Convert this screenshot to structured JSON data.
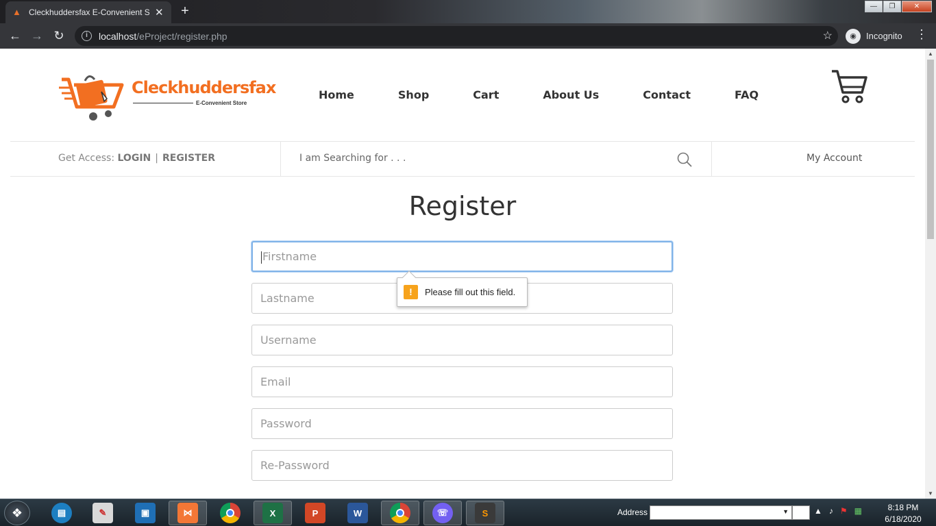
{
  "browser": {
    "tab_title": "Cleckhuddersfax E-Convenient St",
    "tab_close": "✕",
    "new_tab": "+",
    "url_host": "localhost",
    "url_path": "/eProject/register.php",
    "incognito_label": "Incognito"
  },
  "site": {
    "brand": "Cleckhuddersfax",
    "tagline": "E-Convenient Store",
    "nav": [
      "Home",
      "Shop",
      "Cart",
      "About Us",
      "Contact",
      "FAQ"
    ],
    "access_prefix": "Get Access:",
    "login": "LOGIN",
    "separator": "|",
    "register": "REGISTER",
    "search_placeholder": "I am Searching for . . .",
    "my_account": "My Account",
    "brand_color": "#f26f21"
  },
  "form": {
    "title": "Register",
    "fields": [
      {
        "placeholder": "Firstname",
        "value": ""
      },
      {
        "placeholder": "Lastname",
        "value": ""
      },
      {
        "placeholder": "Username",
        "value": ""
      },
      {
        "placeholder": "Email",
        "value": ""
      },
      {
        "placeholder": "Password",
        "value": ""
      },
      {
        "placeholder": "Re-Password",
        "value": ""
      }
    ],
    "validation_message": "Please fill out this field.",
    "validation_icon": "!"
  },
  "taskbar": {
    "address_label": "Address",
    "time": "8:18 PM",
    "date": "6/18/2020",
    "apps": [
      "file-explorer",
      "paint",
      "virtualbox",
      "xampp",
      "chrome",
      "excel",
      "powerpoint",
      "word",
      "chrome-active",
      "viber",
      "sublime-text"
    ]
  }
}
